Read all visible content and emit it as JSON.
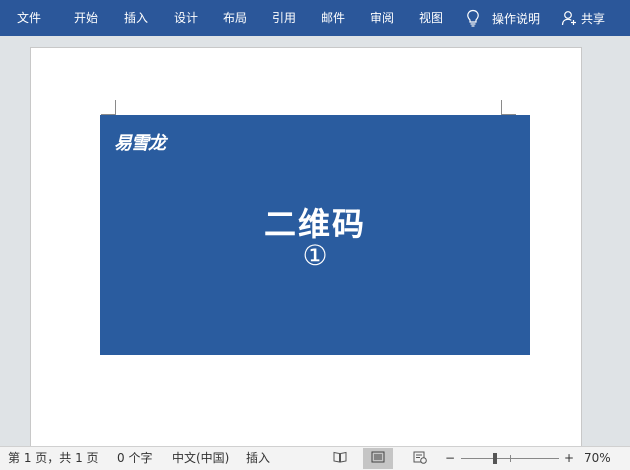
{
  "ribbon": {
    "tabs": [
      "文件",
      "开始",
      "插入",
      "设计",
      "布局",
      "引用",
      "邮件",
      "审阅",
      "视图"
    ],
    "tell_me": "操作说明",
    "share": "共享"
  },
  "document": {
    "logo": "易雪龙",
    "title": "二维码",
    "number": "①",
    "card_color": "#2a5c9f"
  },
  "status_bar": {
    "page_info": "第 1 页，共 1 页",
    "word_count": "0 个字",
    "language": "中文(中国)",
    "mode": "插入",
    "zoom_minus": "−",
    "zoom_plus": "+",
    "zoom_level": "70%",
    "zoom_fraction": 0.35
  },
  "colors": {
    "ribbon": "#2b579a",
    "card": "#2a5c9f"
  }
}
